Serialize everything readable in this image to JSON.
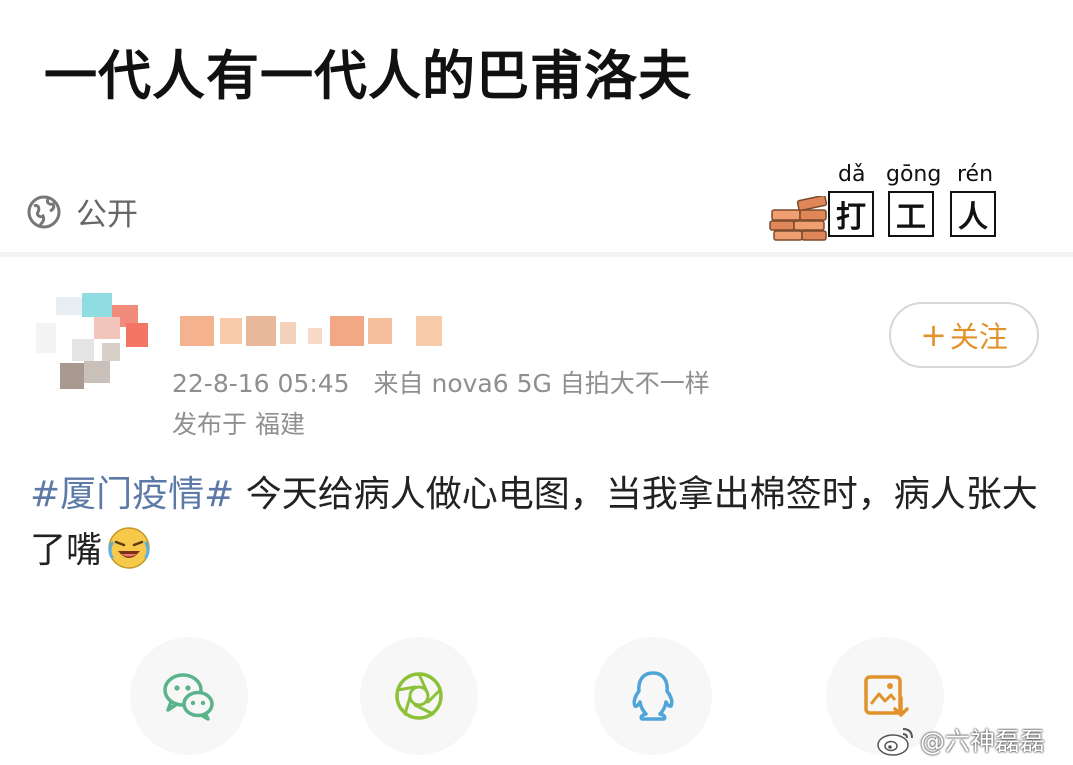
{
  "top": {
    "title": "一代人有一代人的巴甫洛夫",
    "visibility_label": "公开",
    "sticker": {
      "pinyin": [
        "dǎ",
        "gōng",
        "rén"
      ],
      "chars": [
        "打",
        "工",
        "人"
      ]
    }
  },
  "post": {
    "username": "",
    "follow_button": "关注",
    "follow_plus": "+",
    "meta_time": "22-8-16 05:45",
    "meta_source": "来自 nova6 5G 自拍大不一样",
    "location": "发布于 福建",
    "hashtag": "#厦门疫情#",
    "body": " 今天给病人做心电图，当我拿出棉签时，病人张大了嘴",
    "emoji": "laugh-cry-emoji"
  },
  "share_bar": {
    "items": [
      {
        "name": "wechat-icon",
        "color": "#5ab38a"
      },
      {
        "name": "moments-icon",
        "color": "#8ec13a"
      },
      {
        "name": "qq-icon",
        "color": "#4fa4d8"
      },
      {
        "name": "save-image-icon",
        "color": "#e2922b"
      }
    ]
  },
  "watermark": {
    "text": "@六神磊磊"
  },
  "colors": {
    "accent": "#e2922b",
    "hashtag": "#5d79a8",
    "meta": "#8f8f8f"
  }
}
